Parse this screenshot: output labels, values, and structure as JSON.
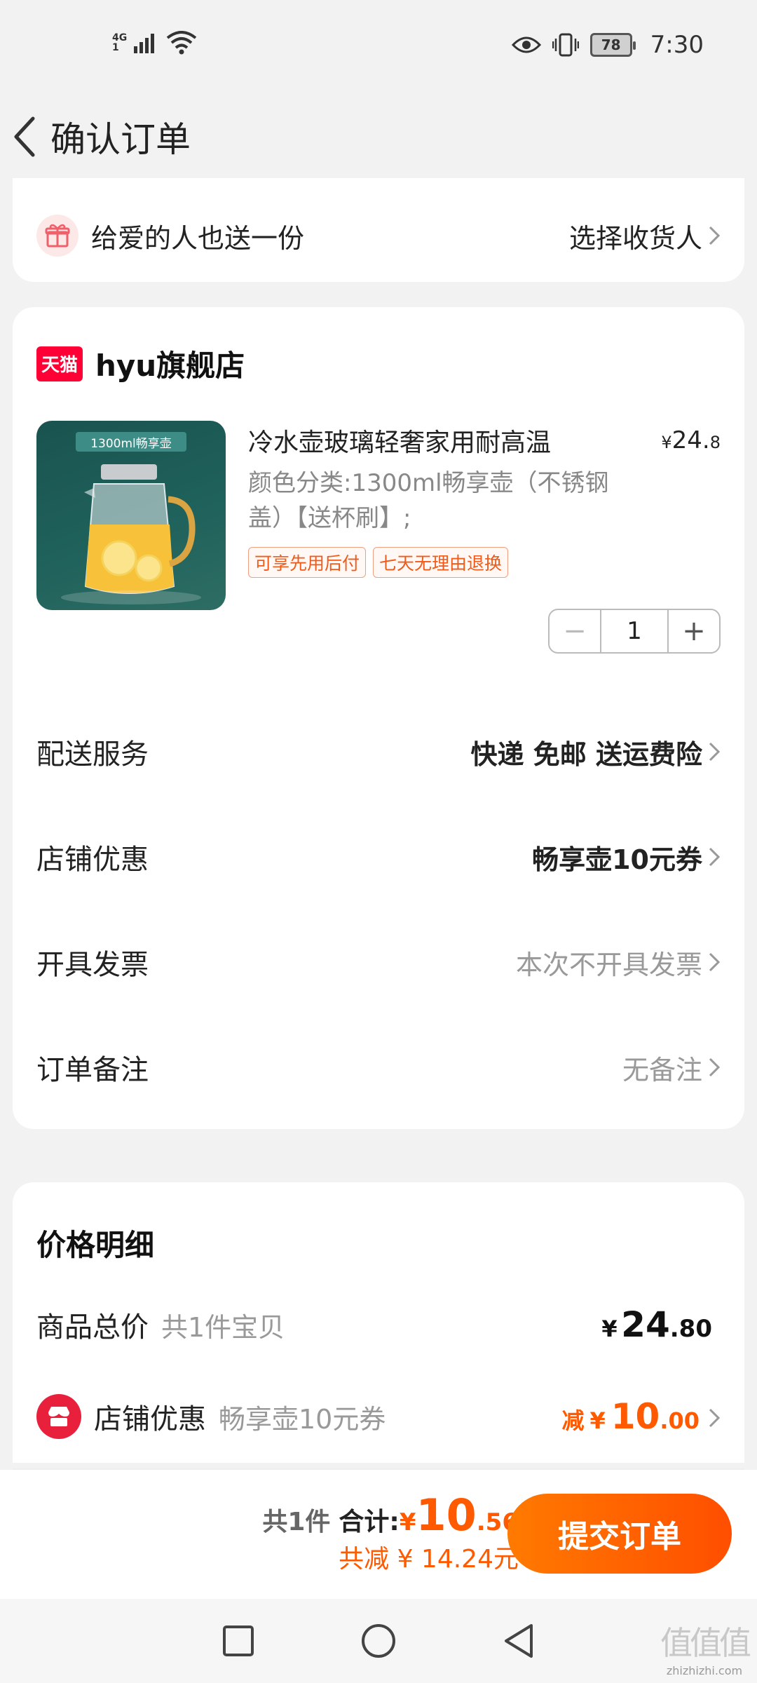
{
  "status_bar": {
    "network": "4G",
    "network_sub": "1",
    "battery": "78",
    "time": "7:30"
  },
  "nav": {
    "title": "确认订单"
  },
  "gift": {
    "text": "给爱的人也送一份",
    "action": "选择收货人"
  },
  "store": {
    "logo_text": "天猫",
    "name": "hyu旗舰店",
    "product": {
      "image_tag": "1300ml畅享壶",
      "title": "冷水壶玻璃轻奢家用耐高温",
      "price_symbol": "¥",
      "price_main": "24.",
      "price_decimal": "8",
      "spec": "颜色分类:1300ml畅享壶（不锈钢盖）【送杯刷】;",
      "tags": [
        "可享先用后付",
        "七天无理由退换"
      ],
      "quantity": "1",
      "minus": "−",
      "plus": "+"
    },
    "options": [
      {
        "label": "配送服务",
        "value": "快递 免邮 送运费险"
      },
      {
        "label": "店铺优惠",
        "value": "畅享壶10元券"
      },
      {
        "label": "开具发票",
        "value": "本次不开具发票"
      },
      {
        "label": "订单备注",
        "value": "无备注"
      }
    ]
  },
  "price_detail": {
    "title": "价格明细",
    "total_label": "商品总价",
    "total_sub": "共1件宝贝",
    "total_symbol": "¥",
    "total_main": "24",
    "total_decimal": ".80",
    "shop_discount_label": "店铺优惠",
    "shop_discount_sub": "畅享壶10元券",
    "discount_prefix": "减",
    "discount_symbol": "¥",
    "discount_main": "10",
    "discount_decimal": ".00"
  },
  "bottom_bar": {
    "count": "共1件",
    "sum_label": "合计:",
    "sum_symbol": "¥",
    "sum_main": "10",
    "sum_decimal": ".56",
    "saved": "共减 ¥ 14.24元",
    "submit": "提交订单"
  },
  "watermark": {
    "mark": "值值值",
    "url": "zhizhizhi.com"
  },
  "colors": {
    "accent": "#ff5a00",
    "tmall_red": "#ff0036",
    "background": "#f2f2f2"
  }
}
